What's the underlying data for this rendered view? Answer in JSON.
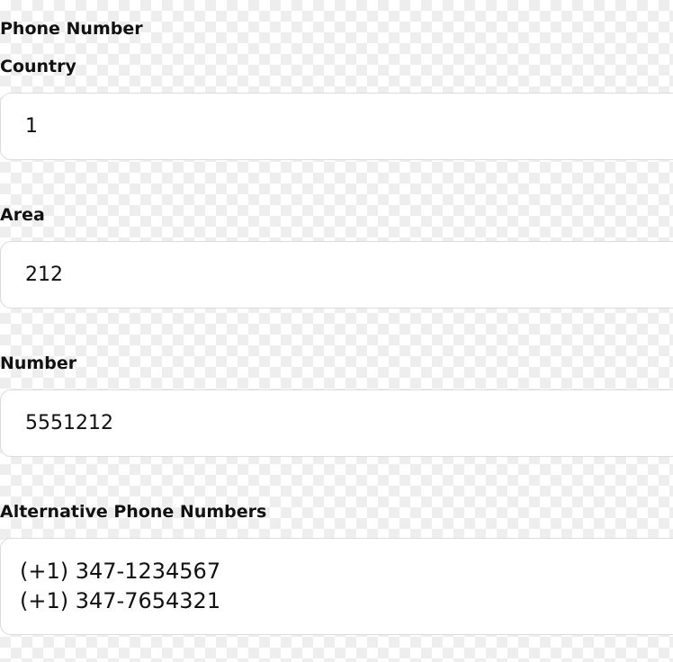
{
  "phone_section": {
    "title": "Phone Number",
    "country": {
      "label": "Country",
      "value": "1"
    },
    "area": {
      "label": "Area",
      "value": "212"
    },
    "number": {
      "label": "Number",
      "value": "5551212"
    }
  },
  "alternative": {
    "label": "Alternative Phone Numbers",
    "value": "(+1) 347-1234567\n(+1) 347-7654321"
  }
}
